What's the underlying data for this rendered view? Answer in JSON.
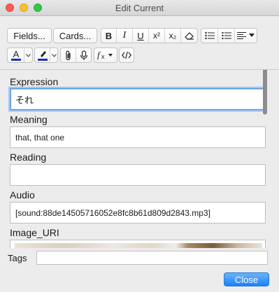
{
  "window": {
    "title": "Edit Current"
  },
  "toolbar": {
    "fields_label": "Fields...",
    "cards_label": "Cards...",
    "bold": "B",
    "italic": "I",
    "underline": "U",
    "superscript": "x²",
    "subscript": "x₂"
  },
  "fields": [
    {
      "label": "Expression",
      "value": "それ"
    },
    {
      "label": "Meaning",
      "value": "that, that one"
    },
    {
      "label": "Reading",
      "value": ""
    },
    {
      "label": "Audio",
      "value": "[sound:88de14505716052e8fc8b61d809d2843.mp3]"
    },
    {
      "label": "Image_URI",
      "value": ""
    }
  ],
  "tags": {
    "label": "Tags",
    "value": ""
  },
  "footer": {
    "close_label": "Close"
  },
  "colors": {
    "accent": "#1a82fb",
    "text_color": "#1c2fc0",
    "highlight": "#1c2fc0",
    "focus": "#6fa4e8"
  }
}
